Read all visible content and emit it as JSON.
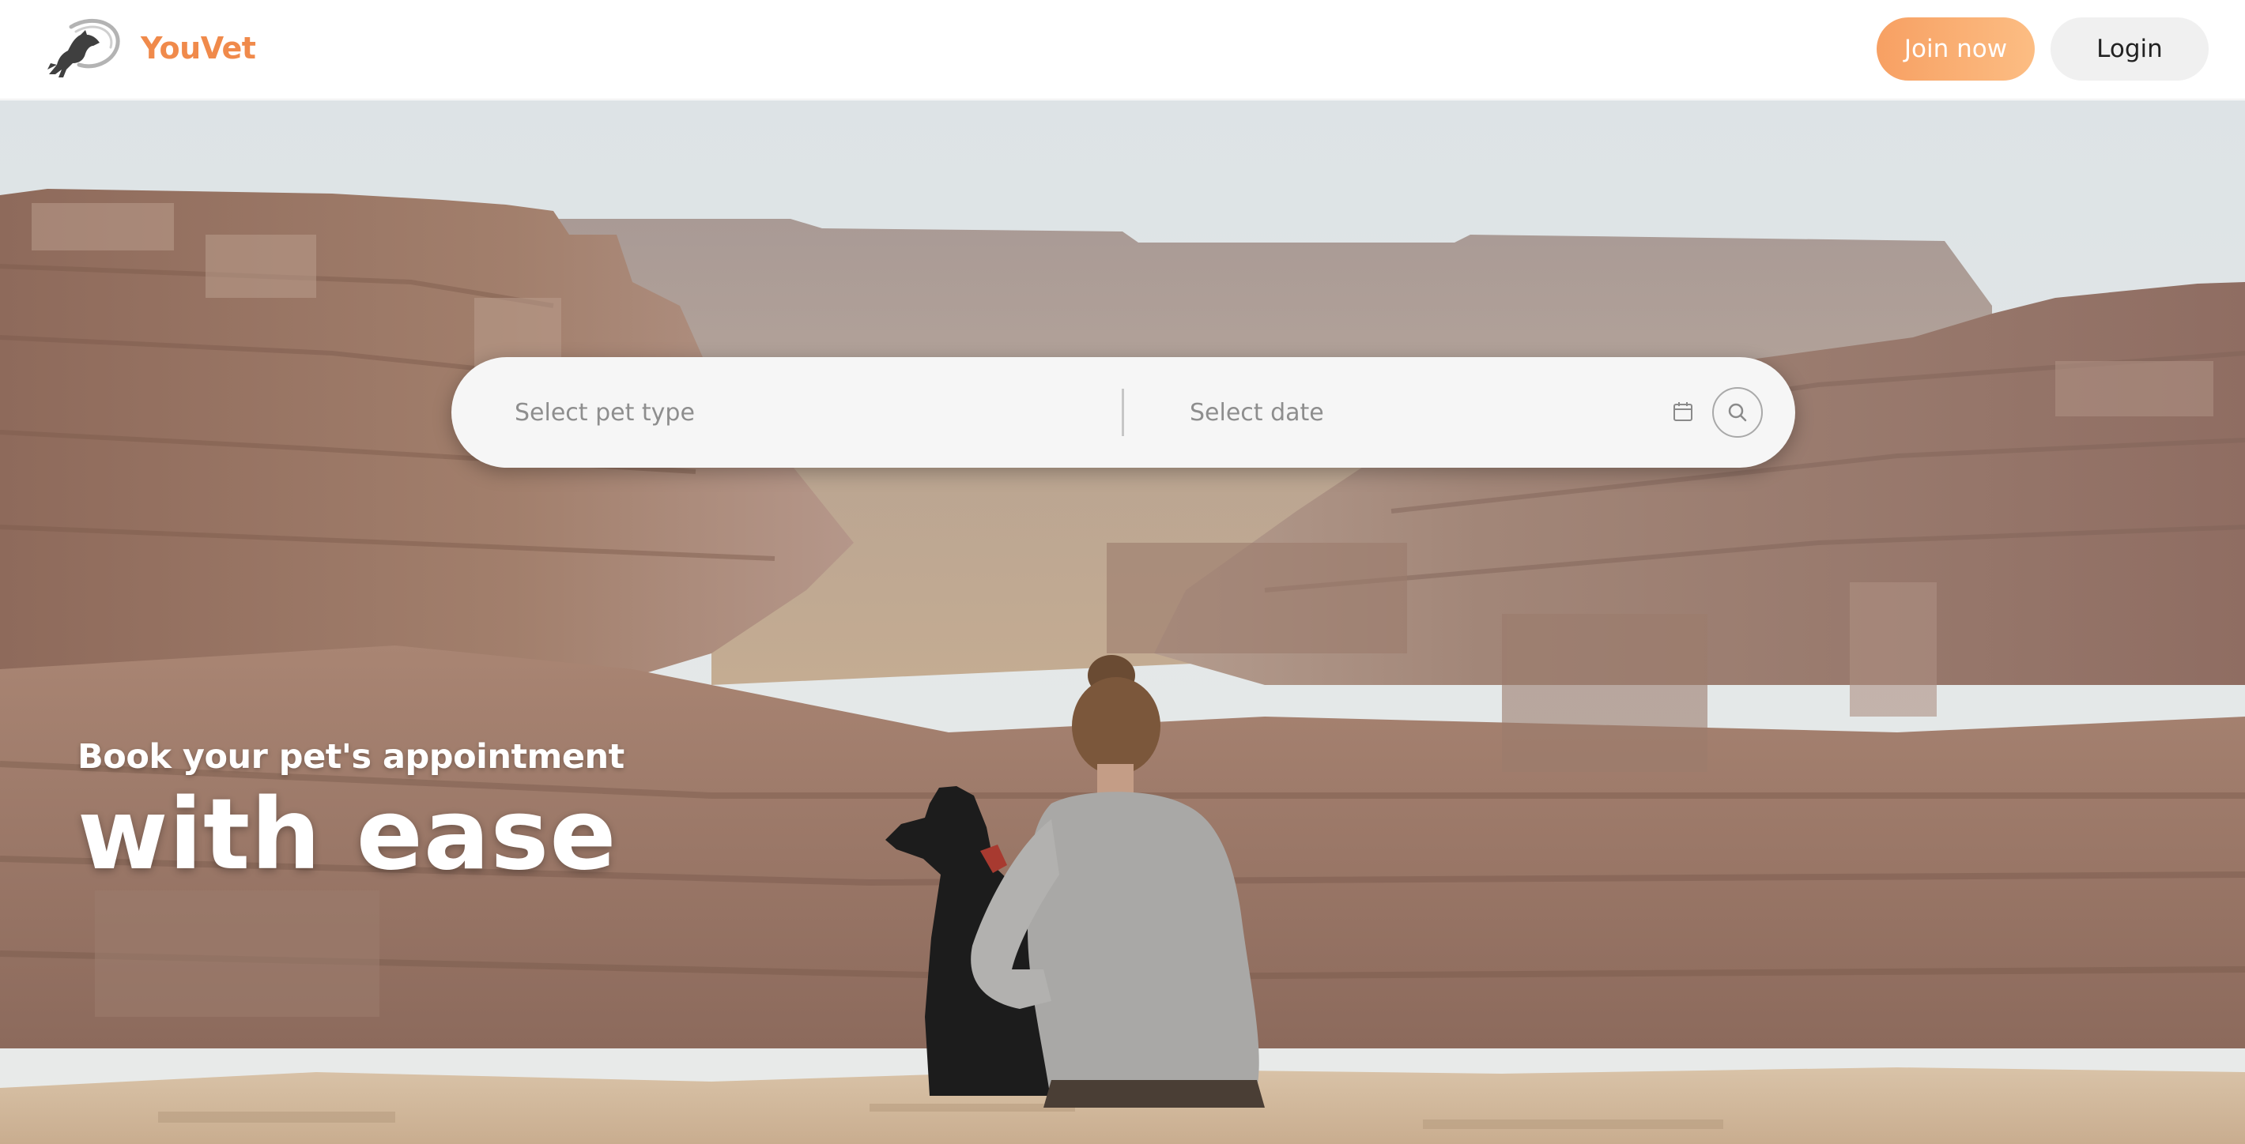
{
  "header": {
    "brand_name": "YouVet",
    "join_label": "Join now",
    "login_label": "Login"
  },
  "search": {
    "pet_type_placeholder": "Select pet type",
    "date_placeholder": "Select date"
  },
  "hero": {
    "subheading": "Book your pet's appointment",
    "heading": "with ease"
  },
  "icons": {
    "logo": "dog-leaping-logo-icon",
    "calendar": "calendar-icon",
    "search": "search-icon"
  },
  "colors": {
    "brand": "#f08a4b",
    "join_gradient_start": "#f7a063",
    "join_gradient_end": "#fcbd83",
    "login_bg": "#f0f0f0",
    "search_bg": "#f6f6f6"
  }
}
